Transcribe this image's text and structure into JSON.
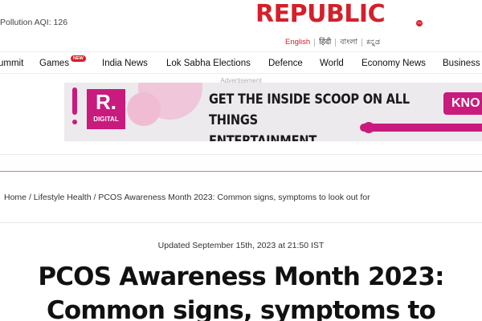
{
  "header": {
    "pollution_text": "Pollution AQI: 126",
    "logo_text": "REPUBLIC",
    "logo_badge": "TV",
    "brand_color": "#d3202a"
  },
  "languages": [
    {
      "label": "English",
      "active": true
    },
    {
      "label": "हिंदी",
      "active": false
    },
    {
      "label": "বাংলা",
      "active": false
    },
    {
      "label": "ಕನ್ನಡ",
      "active": false
    }
  ],
  "nav": {
    "items": [
      "ummit",
      "Games",
      "India News",
      "Lok Sabha Elections",
      "Defence",
      "World",
      "Economy News",
      "Business"
    ],
    "games_badge": "NEW"
  },
  "ad": {
    "label": "Advertisement",
    "logo_letter": "R.",
    "logo_sub": "DIGITAL",
    "headline_line1": "GET THE INSIDE SCOOP ON ALL THINGS",
    "headline_line2": "ENTERTAINMENT",
    "cta": "KNO",
    "accent_color": "#c81b7d"
  },
  "breadcrumb": {
    "items": [
      "Home",
      "Lifestyle Health",
      "PCOS Awareness Month 2023: Common signs, symptoms to look out for"
    ],
    "separator": "/"
  },
  "article": {
    "updated": "Updated September 15th, 2023 at 21:50 IST",
    "title_line1": "PCOS Awareness Month 2023:",
    "title_line2": "Common signs, symptoms to"
  }
}
